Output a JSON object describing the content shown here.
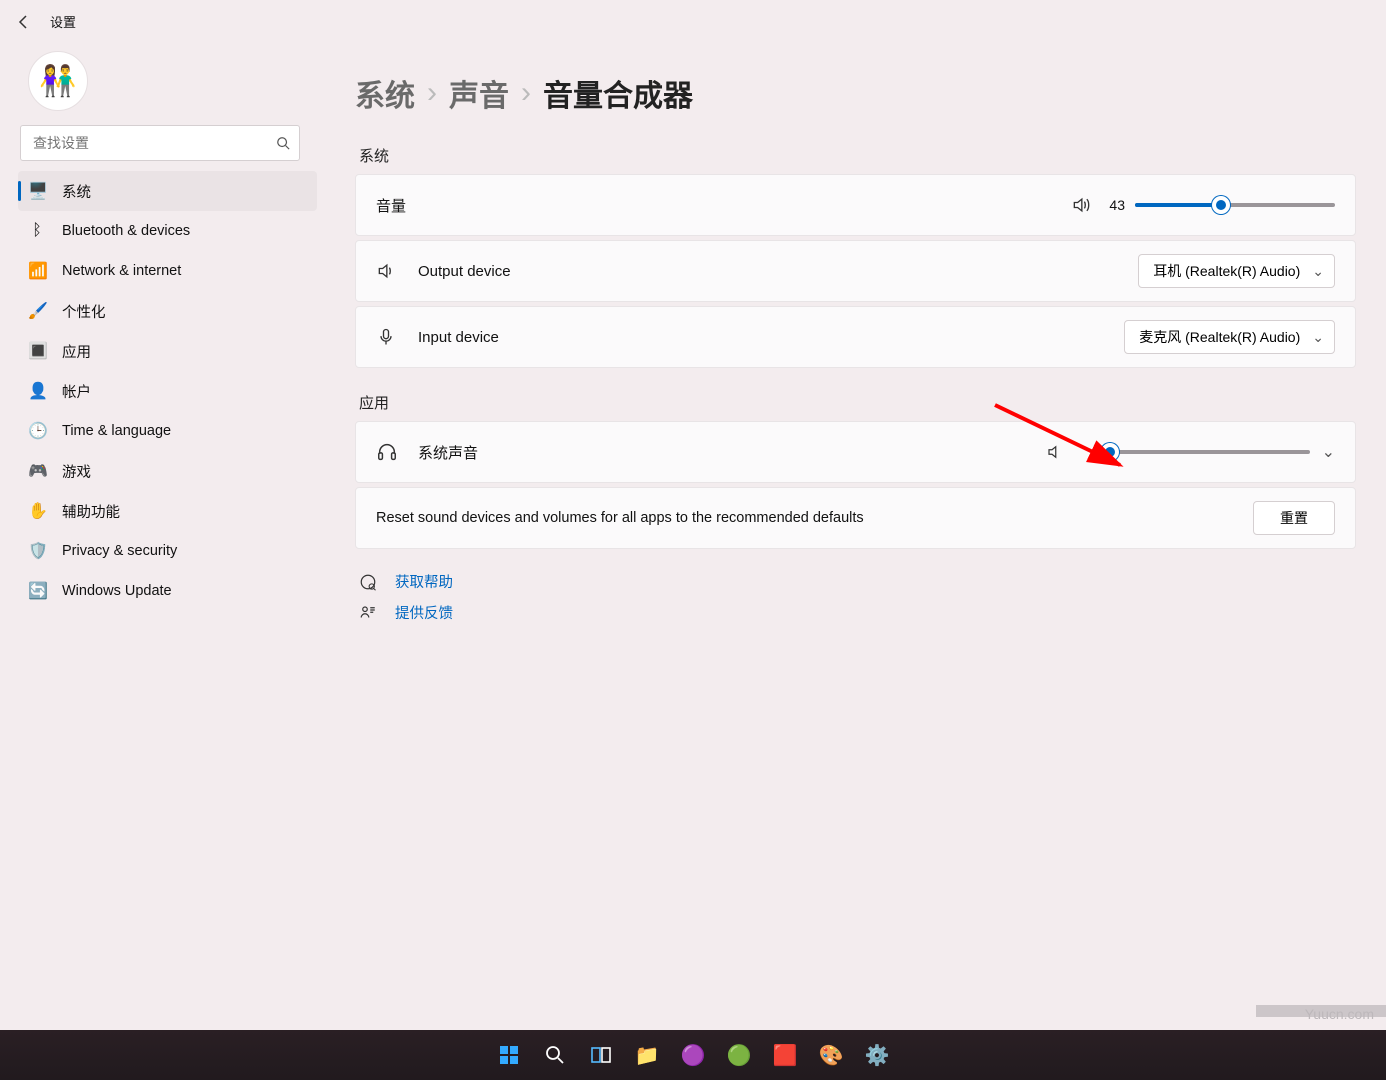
{
  "titlebar": {
    "title": "设置"
  },
  "search": {
    "placeholder": "查找设置"
  },
  "sidebar": {
    "items": [
      {
        "icon": "🖥️",
        "label": "系统",
        "active": true
      },
      {
        "icon": "ᛒ",
        "label": "Bluetooth & devices"
      },
      {
        "icon": "📶",
        "label": "Network & internet"
      },
      {
        "icon": "🖌️",
        "label": "个性化"
      },
      {
        "icon": "🔳",
        "label": "应用"
      },
      {
        "icon": "👤",
        "label": "帐户"
      },
      {
        "icon": "🕒",
        "label": "Time & language"
      },
      {
        "icon": "🎮",
        "label": "游戏"
      },
      {
        "icon": "✋",
        "label": "辅助功能"
      },
      {
        "icon": "🛡️",
        "label": "Privacy & security"
      },
      {
        "icon": "🔄",
        "label": "Windows Update"
      }
    ]
  },
  "breadcrumbs": {
    "a": "系统",
    "b": "声音",
    "c": "音量合成器"
  },
  "sections": {
    "system": "系统",
    "apps": "应用"
  },
  "volume": {
    "label": "音量",
    "value": 43,
    "max": 100
  },
  "output": {
    "label": "Output device",
    "selected": "耳机 (Realtek(R) Audio)"
  },
  "input": {
    "label": "Input device",
    "selected": "麦克风 (Realtek(R) Audio)"
  },
  "app_volume": {
    "label": "系统声音",
    "value": 0,
    "max": 100
  },
  "reset": {
    "text": "Reset sound devices and volumes for all apps to the recommended defaults",
    "button": "重置"
  },
  "footer": {
    "help": "获取帮助",
    "feedback": "提供反馈"
  },
  "watermark": "Yuucn.com"
}
